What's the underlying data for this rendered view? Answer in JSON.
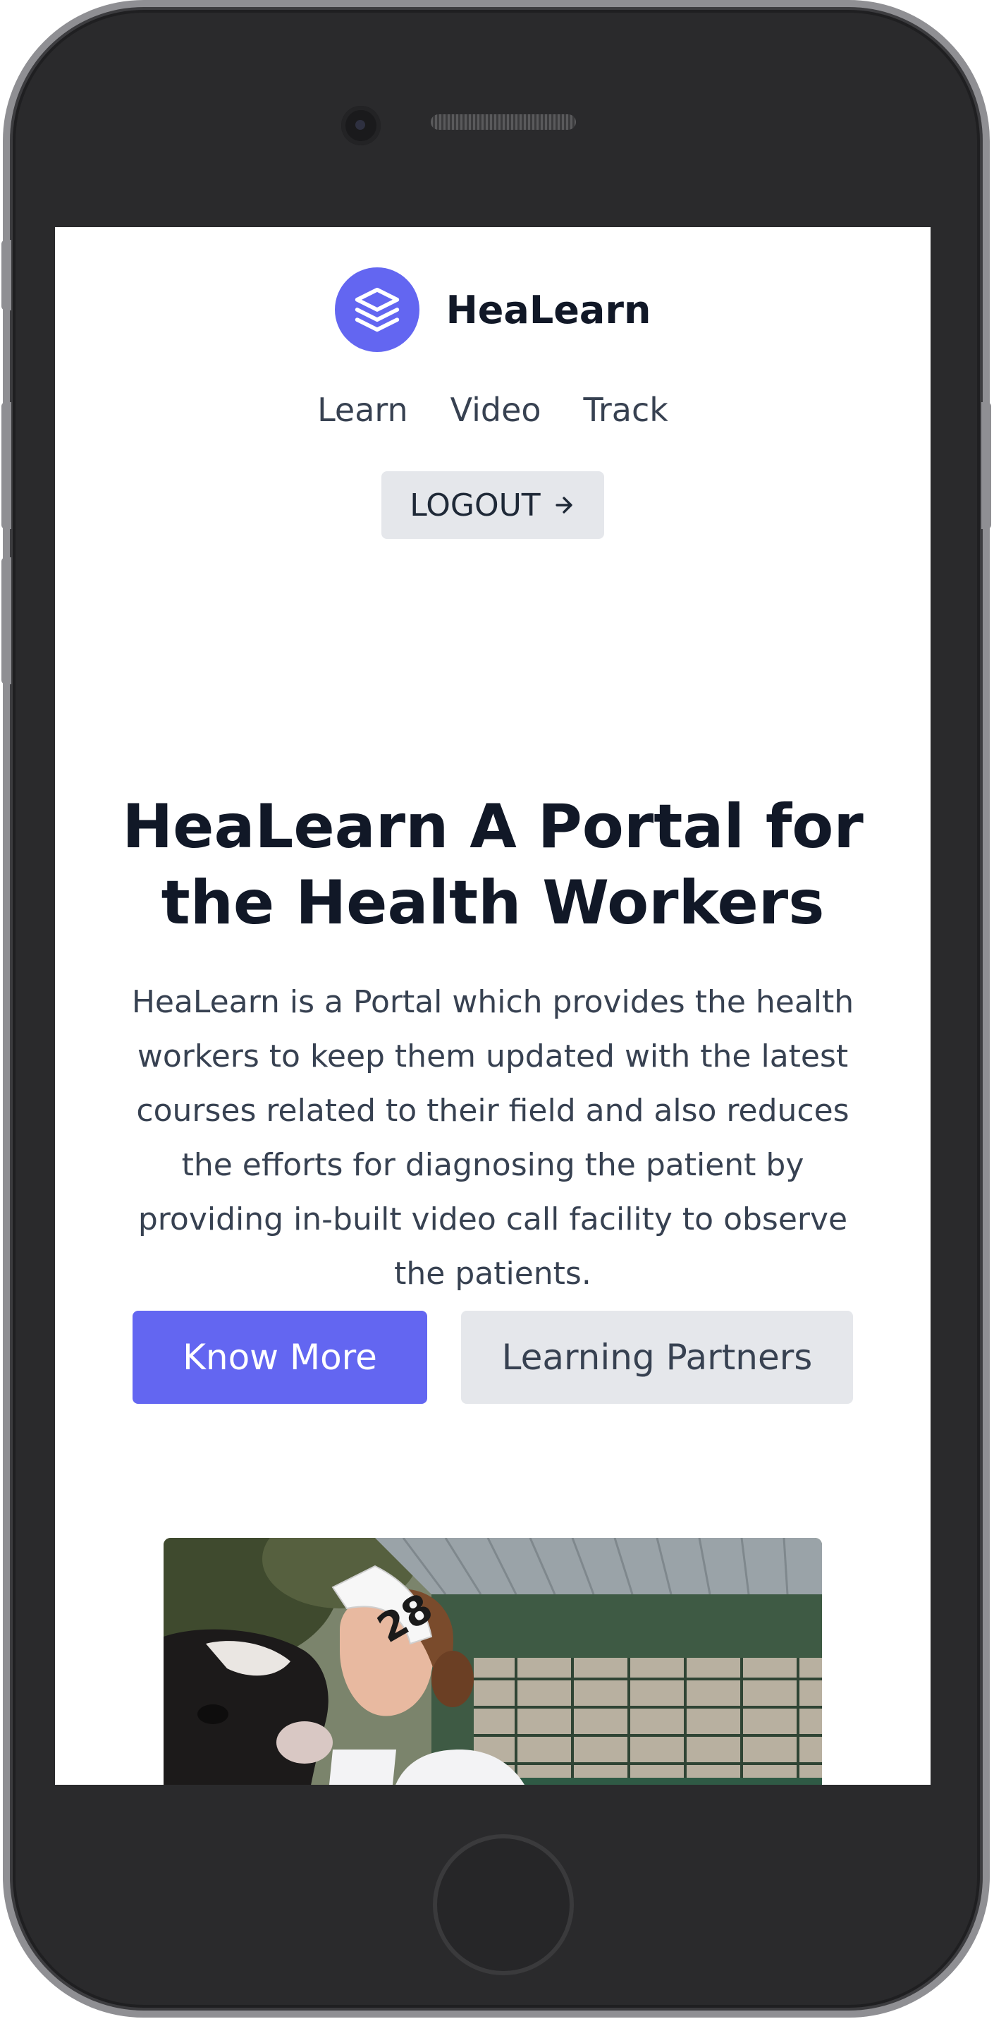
{
  "brand": {
    "name": "HeaLearn",
    "accent_color": "#6366f1",
    "logo_icon": "layers-icon"
  },
  "nav": {
    "items": [
      "Learn",
      "Video",
      "Track"
    ]
  },
  "logout": {
    "label": "LOGOUT",
    "icon": "arrow-right-icon"
  },
  "hero": {
    "title": "HeaLearn A Portal for the Health Workers",
    "description": "HeaLearn is a Portal which provides the health workers to keep them updated with the latest courses related to their field and also reduces the efforts for diagnosing the patient by providing in-built video call facility to observe the patients.",
    "primary_button": "Know More",
    "secondary_button": "Learning Partners",
    "image": {
      "description": "hero-photo",
      "badge_number": "28"
    }
  }
}
